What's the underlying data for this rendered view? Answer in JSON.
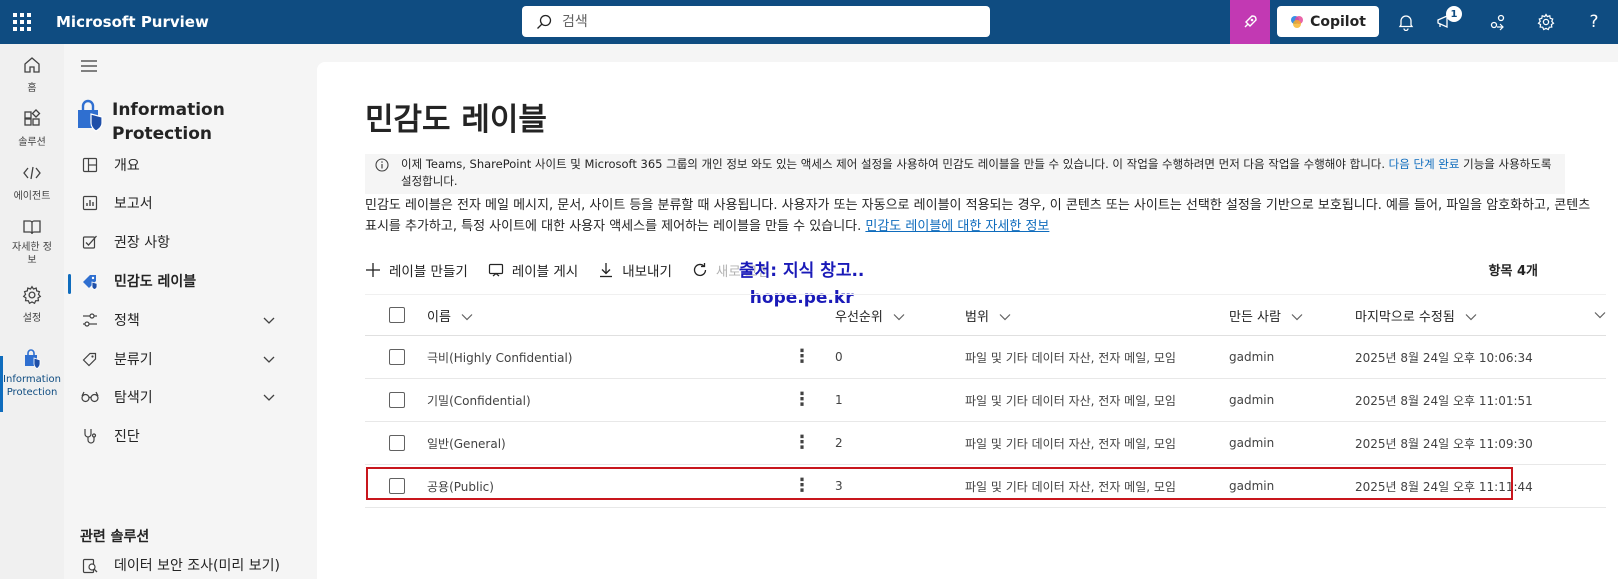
{
  "app": {
    "title": "Microsoft Purview"
  },
  "search": {
    "placeholder": "검색"
  },
  "topbar": {
    "copilot_label": "Copilot",
    "notification_count": "1"
  },
  "rail": {
    "items": [
      {
        "label": "홈"
      },
      {
        "label": "솔루션"
      },
      {
        "label": "에이전트"
      },
      {
        "label": "자세한 정보"
      },
      {
        "label": "설정"
      },
      {
        "label": "Information Protection"
      }
    ]
  },
  "nav": {
    "app_title": "Information Protection",
    "items": [
      {
        "label": "개요"
      },
      {
        "label": "보고서"
      },
      {
        "label": "권장 사항"
      },
      {
        "label": "민감도 레이블"
      },
      {
        "label": "정책"
      },
      {
        "label": "분류기"
      },
      {
        "label": "탐색기"
      },
      {
        "label": "진단"
      }
    ],
    "section_title": "관련 솔루션",
    "related_item": "데이터 보안 조사(미리 보기)"
  },
  "page": {
    "title": "민감도 레이블",
    "info_text": "이제 Teams, SharePoint 사이트 및 Microsoft 365 그룹의 개인 정보 와도 있는 액세스 제어 설정을 사용하여 민감도 레이블을 만들 수 있습니다. 이 작업을 수행하려면 먼저 다음 작업을 수행해야 합니다.",
    "info_link": "다음 단계 완료",
    "info_text_after": "기능을 사용하도록 설정합니다.",
    "description": "민감도 레이블은 전자 메일 메시지, 문서, 사이트 등을 분류할 때 사용됩니다. 사용자가 또는 자동으로 레이블이 적용되는 경우, 이 콘텐츠 또는 사이트는 선택한 설정을 기반으로 보호됩니다. 예를 들어, 파일을 암호화하고, 콘텐츠 표시를 추가하고, 특정 사이트에 대한 사용자 액세스를 제어하는 레이블을 만들 수 있습니다.",
    "description_link": "민감도 레이블에 대한 자세한 정보",
    "item_count": "항목 4개"
  },
  "toolbar": {
    "create_label": "레이블 만들기",
    "publish_label": "레이블 게시",
    "export_label": "내보내기",
    "refresh_label": "새로 고침"
  },
  "watermark": {
    "line1": "출처: 지식 창고..",
    "line2": "hope.pe.kr"
  },
  "table": {
    "headers": {
      "name": "이름",
      "priority": "우선순위",
      "scope": "범위",
      "created_by": "만든 사람",
      "modified": "마지막으로 수정됨"
    },
    "rows": [
      {
        "name": "극비(Highly Confidential)",
        "priority": "0",
        "scope": "파일 및 기타 데이터 자산, 전자 메일, 모임",
        "created_by": "gadmin",
        "modified": "2025년 8월 24일 오후 10:06:34"
      },
      {
        "name": "기밀(Confidential)",
        "priority": "1",
        "scope": "파일 및 기타 데이터 자산, 전자 메일, 모임",
        "created_by": "gadmin",
        "modified": "2025년 8월 24일 오후 11:01:51"
      },
      {
        "name": "일반(General)",
        "priority": "2",
        "scope": "파일 및 기타 데이터 자산, 전자 메일, 모임",
        "created_by": "gadmin",
        "modified": "2025년 8월 24일 오후 11:09:30"
      },
      {
        "name": "공용(Public)",
        "priority": "3",
        "scope": "파일 및 기타 데이터 자산, 전자 메일, 모임",
        "created_by": "gadmin",
        "modified": "2025년 8월 24일 오후 11:11:44"
      }
    ]
  },
  "colors": {
    "topbar": "#0f4c81",
    "accent": "#0f6cbd",
    "copilot_tile": "#c239b3",
    "highlight": "#c8161d"
  }
}
